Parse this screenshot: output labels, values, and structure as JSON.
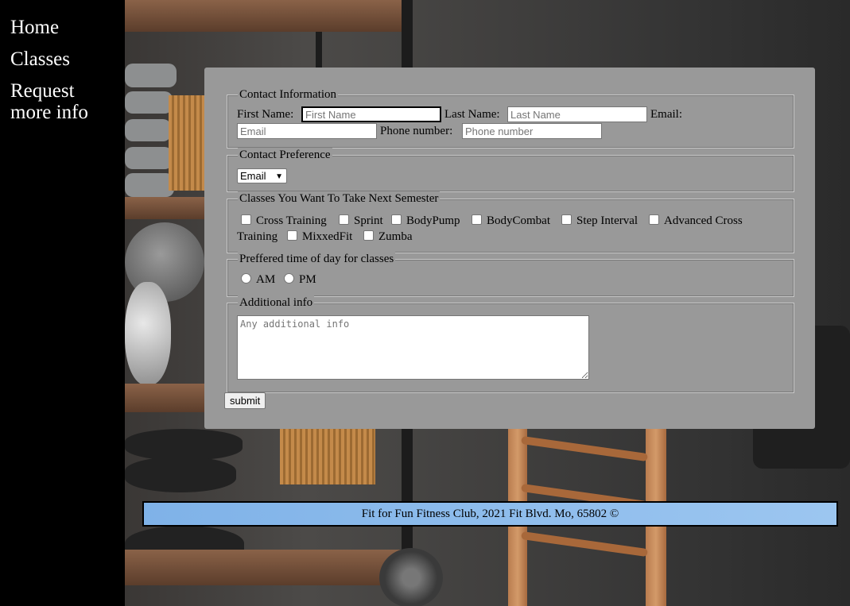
{
  "nav": {
    "items": [
      {
        "label": "Home"
      },
      {
        "label": "Classes"
      },
      {
        "label": "Request more info"
      }
    ]
  },
  "form": {
    "contact_info": {
      "legend": "Contact Information",
      "first_name_label": "First Name:",
      "first_name_placeholder": "First Name",
      "last_name_label": "Last Name:",
      "last_name_placeholder": "Last Name",
      "email_label": "Email:",
      "email_placeholder": "Email",
      "phone_label": "Phone number:",
      "phone_placeholder": "Phone number"
    },
    "contact_preference": {
      "legend": "Contact Preference",
      "selected": "Email"
    },
    "classes": {
      "legend": "Classes You Want To Take Next Semester",
      "options": [
        {
          "label": "Cross Training",
          "checked": false
        },
        {
          "label": "Sprint",
          "checked": false
        },
        {
          "label": "BodyPump",
          "checked": false
        },
        {
          "label": "BodyCombat",
          "checked": false
        },
        {
          "label": "Step Interval",
          "checked": false
        },
        {
          "label": "Advanced Cross",
          "checked": false
        },
        {
          "label": "Training",
          "checked": false
        },
        {
          "label": "MixxedFit",
          "checked": false
        },
        {
          "label": "Zumba",
          "checked": false
        }
      ]
    },
    "time_of_day": {
      "legend": "Preffered time of day for classes",
      "options": [
        {
          "label": "AM",
          "selected": false
        },
        {
          "label": "PM",
          "selected": false
        }
      ]
    },
    "additional_info": {
      "legend": "Additional info",
      "placeholder": "Any additional info"
    },
    "submit_label": "submit"
  },
  "footer": {
    "text": "Fit for Fun Fitness Club, 2021 Fit Blvd. Mo, 65802 ©"
  },
  "colors": {
    "panel": "#999999",
    "footer": "#8fbcec",
    "sidebar": "#000000",
    "nav_text": "#ffffff"
  }
}
